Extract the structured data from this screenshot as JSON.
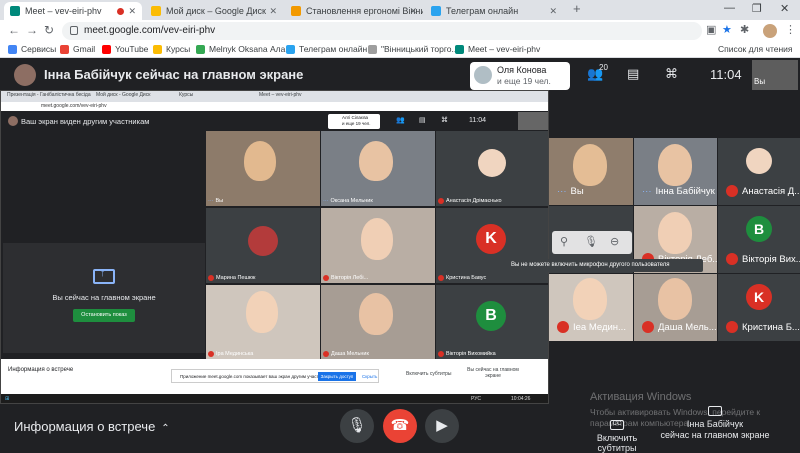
{
  "browser": {
    "tabs": [
      {
        "title": "Meet – vev-eiri-phv",
        "color": "#00897b"
      },
      {
        "title": "Мой диск – Google Диск",
        "color": "#fbbc04"
      },
      {
        "title": "Становлення ергономі Вінниця",
        "color": "#f29900"
      },
      {
        "title": "Телеграм онлайн",
        "color": "#2aa3ef"
      }
    ],
    "new_tab": "+",
    "url": "meet.google.com/vev-eiri-phv",
    "bookmarks": [
      {
        "label": "Сервисы",
        "color": "#4285f4"
      },
      {
        "label": "Gmail",
        "color": "#ea4335"
      },
      {
        "label": "YouTube",
        "color": "#ff0000"
      },
      {
        "label": "Курсы",
        "color": "#fbbc04"
      },
      {
        "label": "Melnyk Oksana Ала...",
        "color": "#34a853"
      },
      {
        "label": "Телеграм онлайн",
        "color": "#2aa3ef"
      },
      {
        "label": "\"Вінницький торго...",
        "color": "#9e9e9e"
      },
      {
        "label": "Meet – vev-eiri-phv",
        "color": "#00897b"
      }
    ],
    "reading_list": "Список для чтения"
  },
  "meet": {
    "presenter_text": "Інна Бабійчук сейчас на главном экране",
    "chip_name": "Оля Конова",
    "chip_more": "и еще 19 чел.",
    "people_count": "20",
    "clock": "11:04",
    "self_label": "Вы",
    "shared_screen": {
      "tabs": [
        "Презентація - Ганібалістична бесіда",
        "Мой диск - Google Диск",
        "Курсы",
        "Meet – vev-eiri-phv"
      ],
      "url": "meet.google.com/vev-eiri-phv",
      "header": "Ваш экран виден другим участникам",
      "chip_name": "Алгі Сілаєва",
      "chip_more": "и еще 19 чел.",
      "clock": "11:04",
      "present_text": "Вы сейчас на главном экране",
      "stop_button": "Остановить показ",
      "tiles": [
        {
          "name": "Вы"
        },
        {
          "name": "Оксана Мельник"
        },
        {
          "name": "Анастасія Дрімаєнько"
        },
        {
          "name": "Марина Пешюк"
        },
        {
          "name": "Вікторія Лебі..."
        },
        {
          "name": "Кристина Бавус"
        },
        {
          "name": "Іра Мединська"
        },
        {
          "name": "Даша Мельник"
        },
        {
          "name": "Вікторія Вихомийка"
        }
      ],
      "info": "Информация о встрече",
      "notify_text": "Приложение meet.google.com показывает ваш экран другим участникам.",
      "notify_ok": "Закрыть доступ",
      "notify_hide": "Скрыть",
      "subs": "Включить субтитры",
      "status": "Вы сейчас на главном экране",
      "taskbar_time": "10:04:26",
      "taskbar_date": "25.03.2021",
      "taskbar_lang": "РУС"
    },
    "grid": [
      {
        "name": "Вы",
        "muted": false
      },
      {
        "name": "Інна Бабійчук",
        "muted": false
      },
      {
        "name": "Анастасія Д...",
        "muted": true
      },
      {
        "name": "Вікторія Леб...",
        "muted": true
      },
      {
        "name": "Вікторія Вих...",
        "muted": true,
        "initial": "В",
        "color": "#1e8e3e"
      },
      {
        "name": "Іеа Медин...",
        "muted": true
      },
      {
        "name": "Даша Мель...",
        "muted": true
      },
      {
        "name": "Кристина Б...",
        "muted": true,
        "initial": "K",
        "color": "#d93025"
      }
    ],
    "tooltip": "Вы не можете включить микрофон другого пользователя",
    "activation_title": "Активация Windows",
    "activation_text": "Чтобы активировать Windows, перейдите к параметрам компьютера.",
    "bottom": {
      "info": "Информация о встрече",
      "subtitles": "Включить субтитры",
      "presenting_line1": "Інна Бабійчук",
      "presenting_line2": "сейчас на главном экране"
    }
  }
}
